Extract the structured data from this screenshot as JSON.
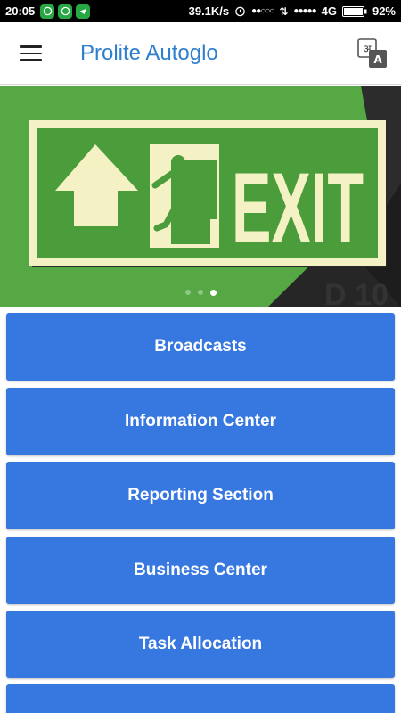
{
  "status_bar": {
    "time": "20:05",
    "speed": "39.1K/s",
    "signal_dots": "●●○○○",
    "signal_dots_2": "●●●●●",
    "network": "4G",
    "battery": "92%"
  },
  "app_bar": {
    "title": "Prolite Autoglo",
    "menu_icon": "hamburger-menu-icon",
    "translate_icon": "translate-icon"
  },
  "banner": {
    "sign_text": "EXIT",
    "corner_text": "D 10",
    "slide_count": 3,
    "active_slide": 3,
    "colors": {
      "green": "#55a843",
      "sign_green": "#4a9d3a",
      "sign_cream": "#f4f1c4",
      "dark": "#1d1d1d"
    }
  },
  "menu": {
    "items": [
      {
        "label": "Broadcasts"
      },
      {
        "label": "Information Center"
      },
      {
        "label": "Reporting Section"
      },
      {
        "label": "Business Center"
      },
      {
        "label": "Task Allocation"
      },
      {
        "label": ""
      }
    ],
    "button_color": "#3778e0"
  }
}
